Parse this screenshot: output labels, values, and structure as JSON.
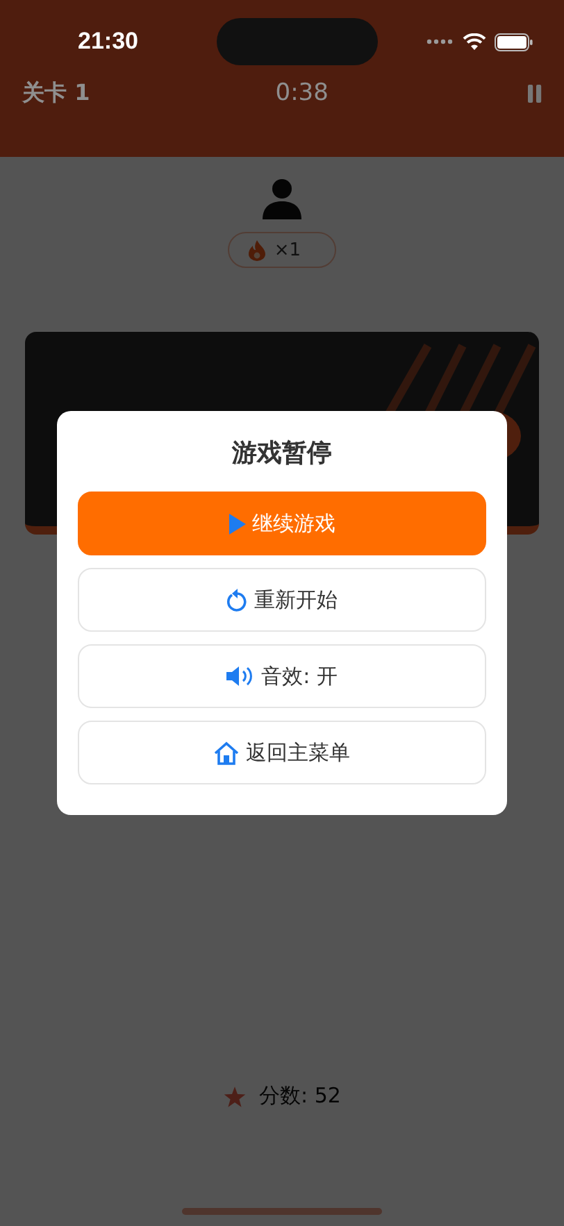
{
  "status_bar": {
    "time": "21:30"
  },
  "header": {
    "level": "关卡 1",
    "timer": "0:38"
  },
  "combo_badge": {
    "text": "×1"
  },
  "score": {
    "text": "分数: 52"
  },
  "pause_dialog": {
    "title": "游戏暂停",
    "buttons": [
      {
        "kind": "resume",
        "highlighted": true,
        "label": "继续游戏"
      },
      {
        "kind": "restart",
        "highlighted": false,
        "label": "重新开始"
      },
      {
        "kind": "sound",
        "highlighted": false,
        "label": "音效: 开"
      },
      {
        "kind": "home",
        "highlighted": false,
        "label": "返回主菜单"
      }
    ]
  }
}
